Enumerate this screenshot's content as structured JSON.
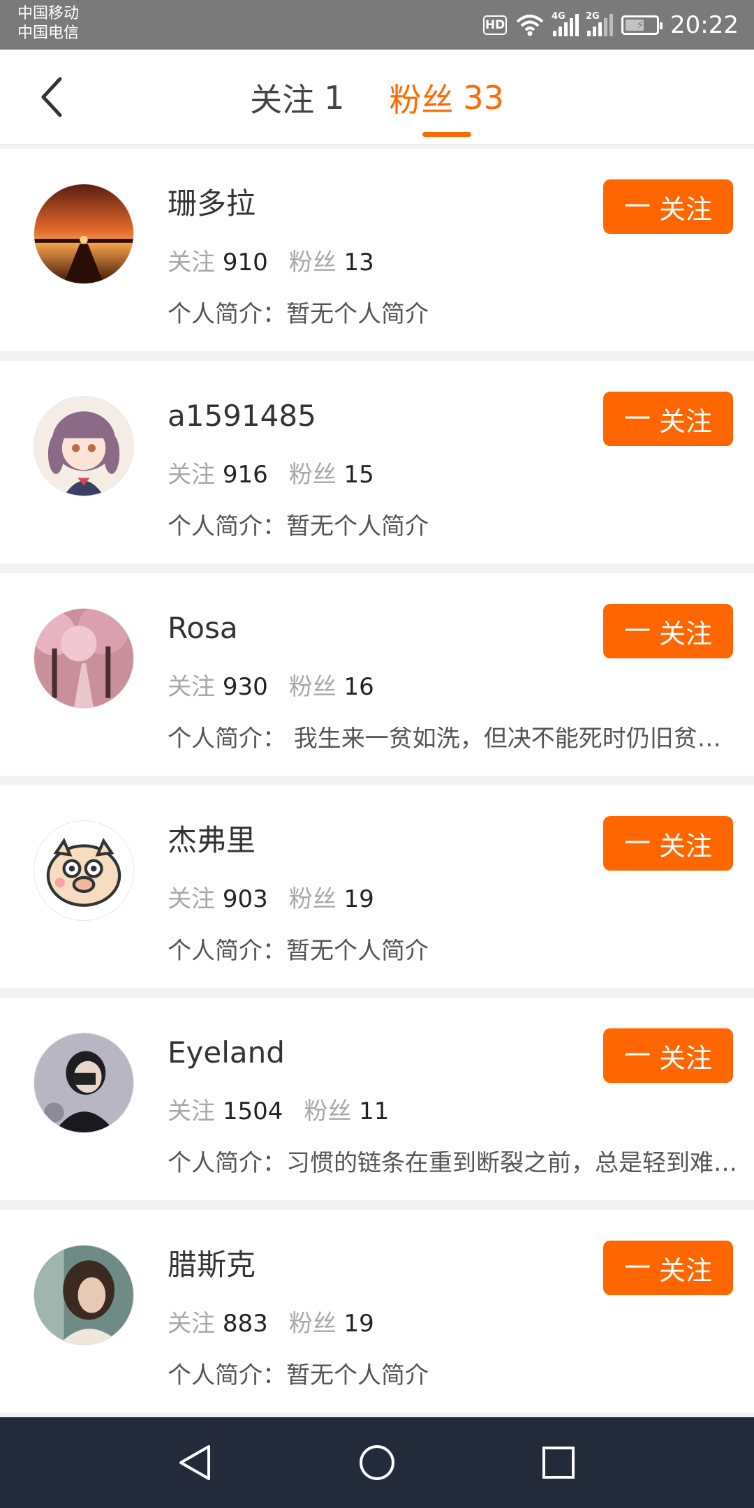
{
  "status_bar": {
    "carrier_1": "中国移动",
    "carrier_2": "中国电信",
    "hd": "HD",
    "sim1_net": "4G",
    "sim2_net": "2G",
    "time": "20:22"
  },
  "header": {
    "tabs": [
      {
        "label": "关注",
        "count": "1"
      },
      {
        "label": "粉丝",
        "count": "33"
      }
    ],
    "active_tab": 1
  },
  "labels": {
    "following": "关注",
    "fans": "粉丝",
    "bio_prefix": "个人简介："
  },
  "users": [
    {
      "name": "珊多拉",
      "following": "910",
      "fans": "13",
      "bio": "暂无个人简介",
      "button": "关注",
      "button_icon": "一",
      "avatar": "sunset-pier"
    },
    {
      "name": "a1591485",
      "following": "916",
      "fans": "15",
      "bio": "暂无个人简介",
      "button": "关注",
      "button_icon": "一",
      "avatar": "anime-girl"
    },
    {
      "name": "Rosa",
      "following": "930",
      "fans": "16",
      "bio": " 我生来一贫如洗，但决不能死时仍旧贫困潦倒",
      "button": "关注",
      "button_icon": "一",
      "avatar": "cherry-blossom"
    },
    {
      "name": "杰弗里",
      "following": "903",
      "fans": "19",
      "bio": "暂无个人简介",
      "button": "关注",
      "button_icon": "一",
      "avatar": "cartoon-pig"
    },
    {
      "name": "Eyeland",
      "following": "1504",
      "fans": "11",
      "bio": "习惯的链条在重到断裂之前，总是轻到难以察觉",
      "button": "关注",
      "button_icon": "一",
      "avatar": "person-phone"
    },
    {
      "name": "腊斯克",
      "following": "883",
      "fans": "19",
      "bio": "暂无个人简介",
      "button": "关注",
      "button_icon": "一",
      "avatar": "girl-portrait"
    }
  ],
  "colors": {
    "accent": "#ff6600",
    "status_bar": "#7a7a7a",
    "nav_bar": "#232b3a"
  }
}
